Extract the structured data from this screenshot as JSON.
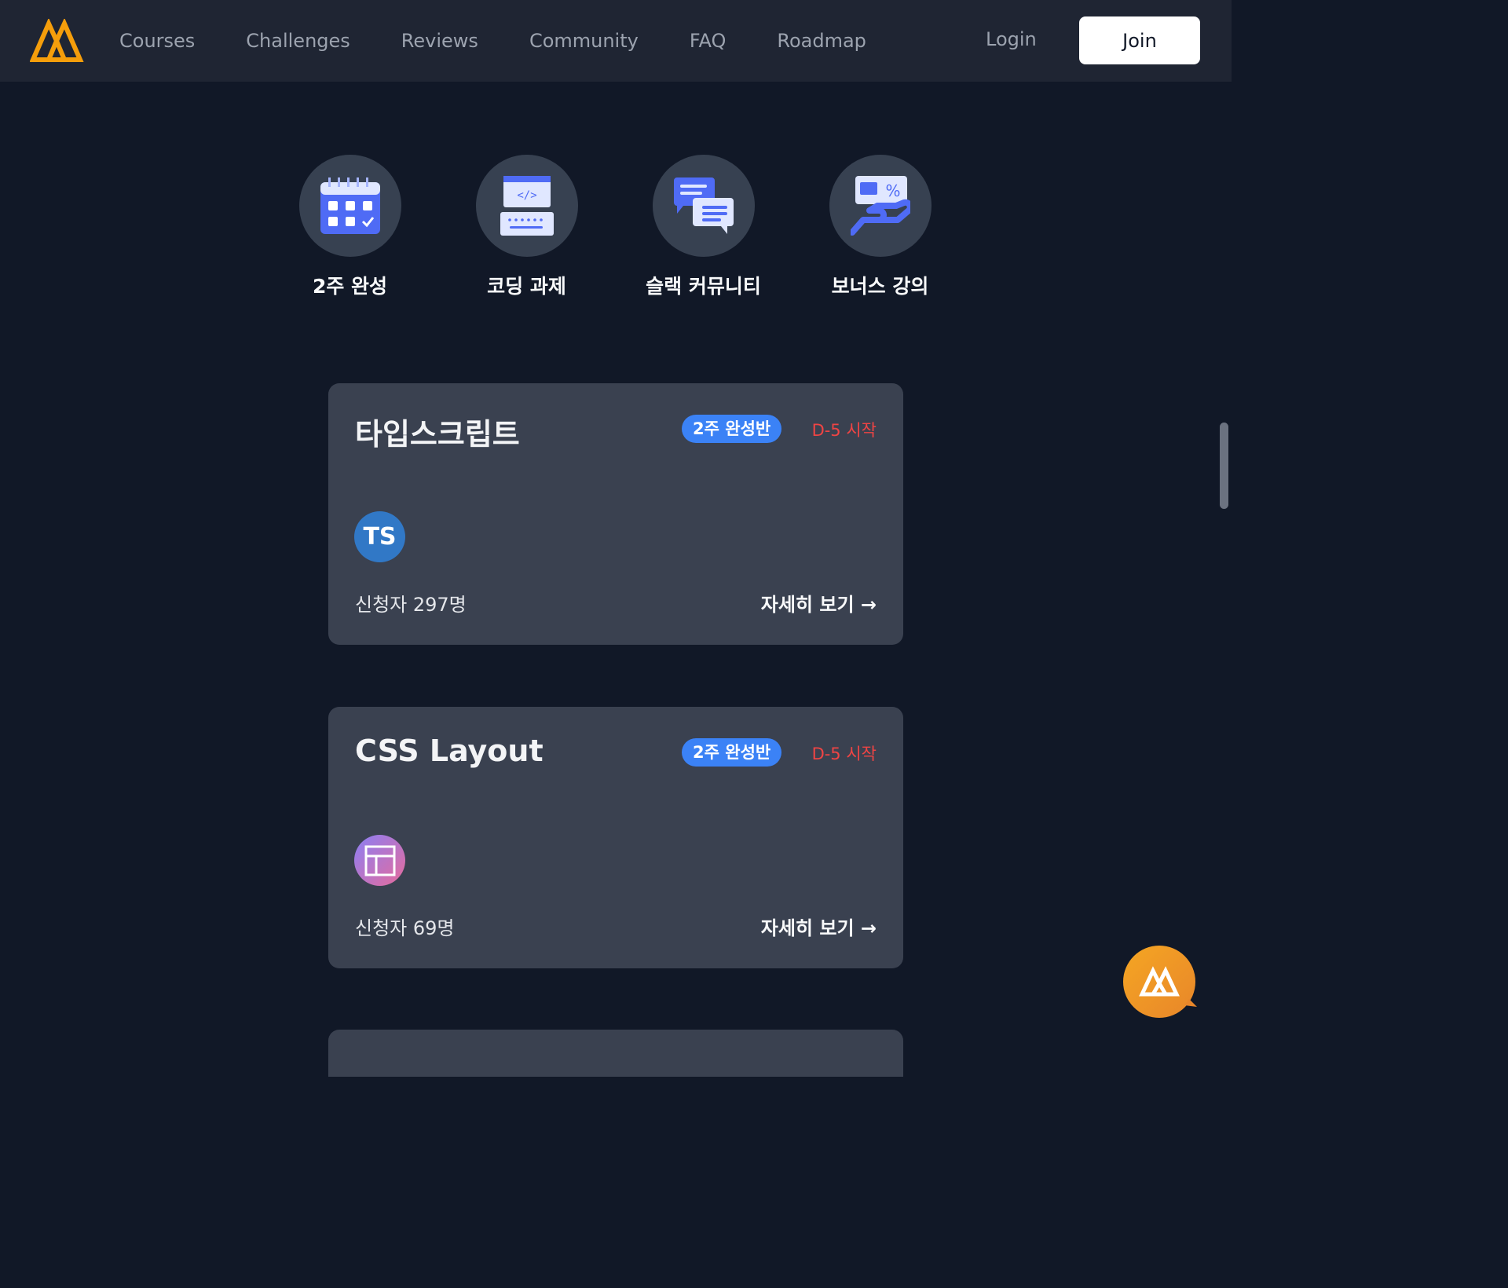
{
  "nav": {
    "links": [
      "Courses",
      "Challenges",
      "Reviews",
      "Community",
      "FAQ",
      "Roadmap"
    ],
    "login": "Login",
    "join": "Join"
  },
  "features": [
    {
      "label": "2주 완성",
      "icon": "calendar-icon"
    },
    {
      "label": "코딩 과제",
      "icon": "code-keyboard-icon"
    },
    {
      "label": "슬랙 커뮤니티",
      "icon": "chat-bubbles-icon"
    },
    {
      "label": "보너스 강의",
      "icon": "bonus-hand-icon"
    }
  ],
  "courses": [
    {
      "title": "타입스크립트",
      "badge": "2주 완성반",
      "dday": "D-5 시작",
      "icon_text": "TS",
      "count": "신청자 297명",
      "more": "자세히 보기 →"
    },
    {
      "title": "CSS Layout",
      "badge": "2주 완성반",
      "dday": "D-5 시작",
      "icon": "layout-icon",
      "count": "신청자 69명",
      "more": "자세히 보기 →"
    }
  ],
  "colors": {
    "accent": "#f59e0b",
    "badge": "#3b82f6",
    "dday": "#ef4444",
    "background": "#111827",
    "card": "#3a4150"
  }
}
